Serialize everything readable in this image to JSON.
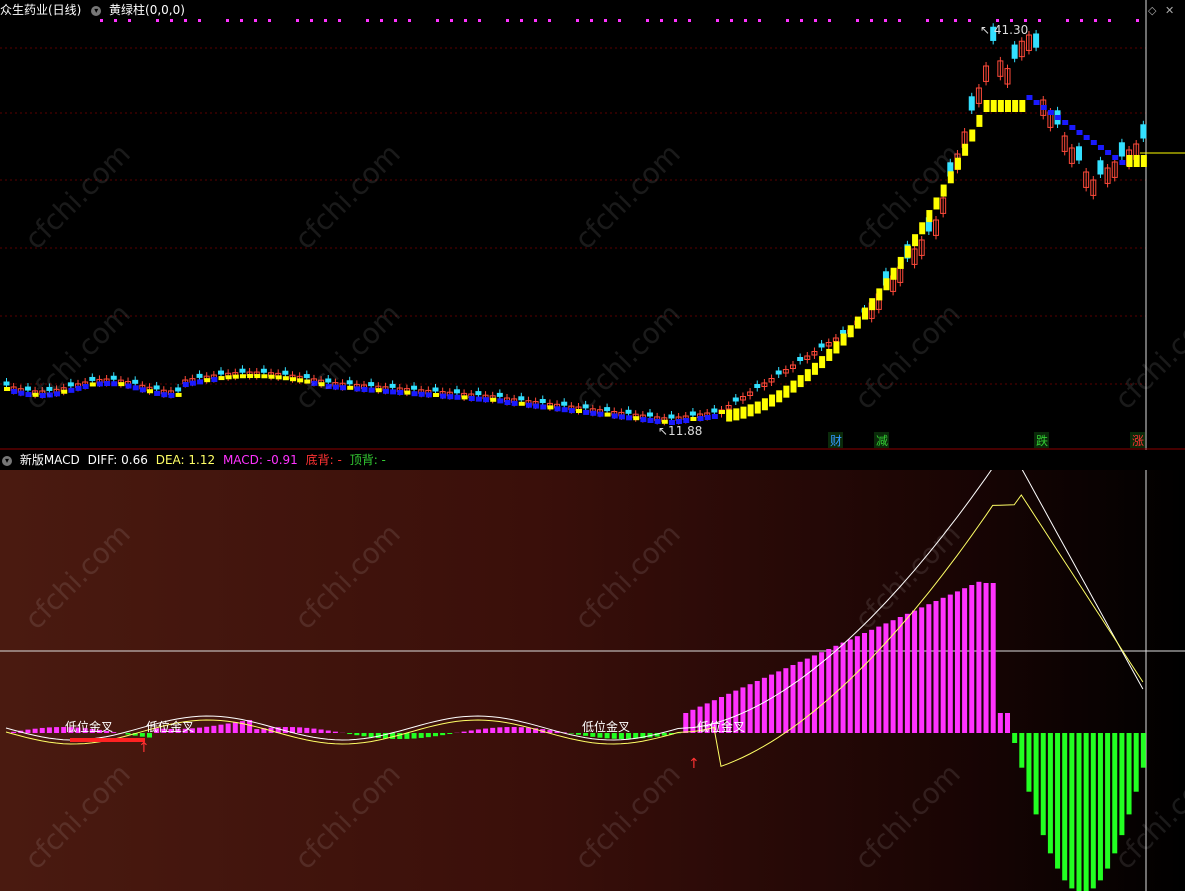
{
  "main": {
    "stock_label": "众生药业(日线)",
    "indicator_label": "黄绿柱(0,0,0)",
    "high_label": "41.30",
    "low_label": "11.88",
    "signals": [
      {
        "text": "财",
        "color": "#3399ff"
      },
      {
        "text": "减",
        "color": "#33cc33"
      },
      {
        "text": "跌",
        "color": "#33cc33"
      },
      {
        "text": "涨",
        "color": "#ff3333"
      }
    ]
  },
  "macd": {
    "name": "新版MACD",
    "diff_label": "DIFF: 0.66",
    "dea_label": "DEA: 1.12",
    "macd_label": "MACD: -0.91",
    "bottom_div_label": "底背: -",
    "top_div_label": "顶背: -",
    "annotations": [
      "低位金叉",
      "低位金叉",
      "低位金叉",
      "低位金叉"
    ]
  },
  "watermark": "cfchi.com",
  "colors": {
    "up": "#ff4a3a",
    "down": "#33e0ff",
    "yellow_bar": "#ffff00",
    "blue_bar": "#1a1aff",
    "hist_pos": "#ff33ff",
    "hist_neg": "#22ff22",
    "diff_line": "#ffffff",
    "dea_line": "#ffff66"
  }
}
